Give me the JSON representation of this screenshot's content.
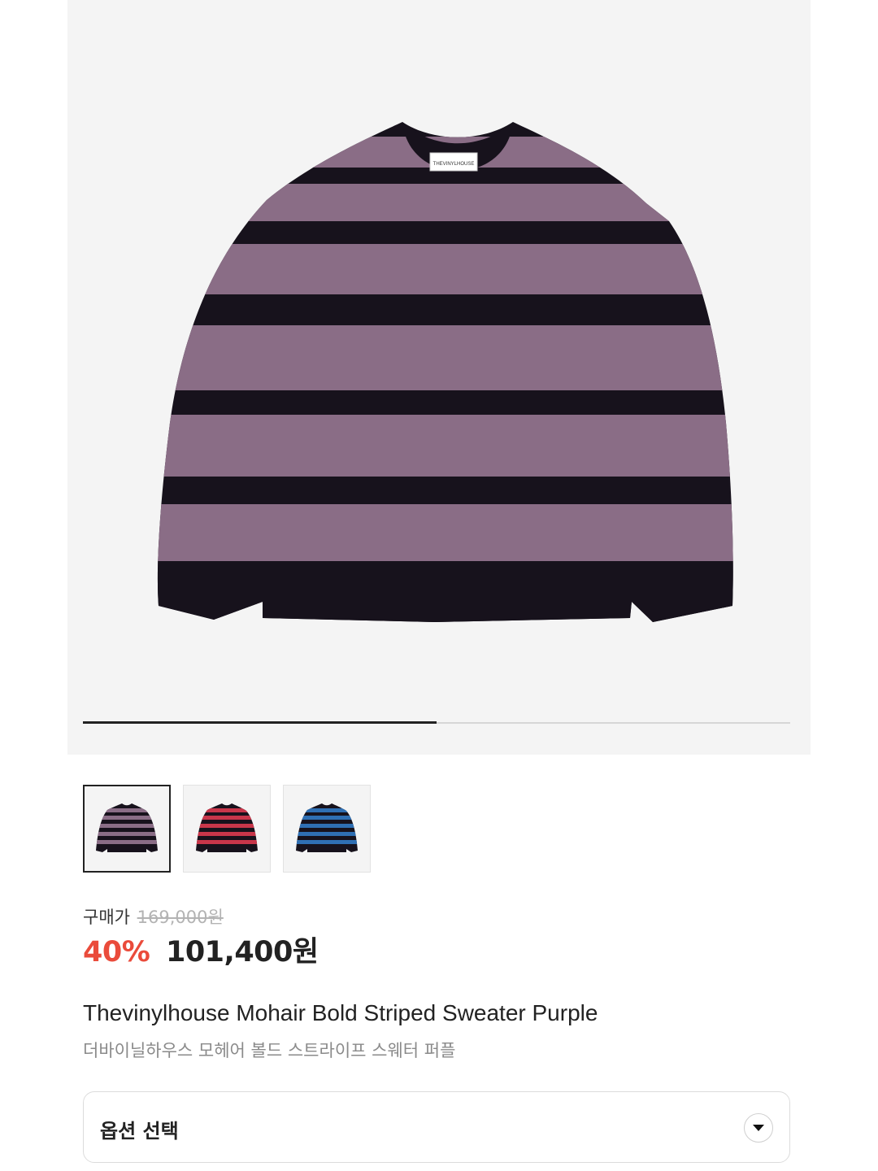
{
  "product": {
    "images": [
      {
        "alt": "purple",
        "stripe_color": "#8a6d86"
      },
      {
        "alt": "red",
        "stripe_color": "#c8364a"
      },
      {
        "alt": "blue",
        "stripe_color": "#2f6fb3"
      }
    ],
    "gallery_progress": 0.5,
    "label_tag": "THEVINYLHOUSE",
    "price": {
      "label": "구매가",
      "original": "169,000원",
      "discount": "40%",
      "sale": "101,400원"
    },
    "title_en": "Thevinylhouse Mohair Bold Striped Sweater Purple",
    "title_ko": "더바이닐하우스 모헤어 볼드 스트라이프 스웨터 퍼플"
  },
  "option_select": {
    "label": "옵션 선택",
    "icon": "chevron-down-icon"
  },
  "colors": {
    "sweater_dark": "#17121c",
    "discount_red": "#ea4b3b"
  }
}
